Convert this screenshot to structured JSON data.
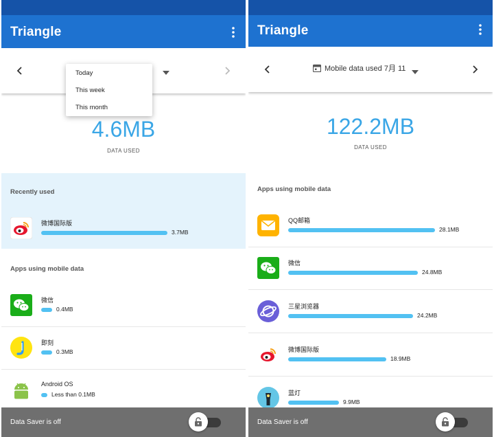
{
  "left": {
    "app_title": "Triangle",
    "usage": {
      "value": "4.6MB",
      "caption": "DATA USED"
    },
    "dropdown_options": [
      "Today",
      "This week",
      "This month"
    ],
    "recent_header": "Recently used",
    "recent_apps": [
      {
        "name": "微博国际版",
        "size": "3.7MB",
        "fraction": 0.8,
        "icon": "weibo-icon"
      }
    ],
    "apps_header": "Apps using mobile data",
    "apps": [
      {
        "name": "微信",
        "size": "0.4MB",
        "fraction": 0.07,
        "icon": "wechat-icon"
      },
      {
        "name": "即刻",
        "size": "0.3MB",
        "fraction": 0.07,
        "icon": "jike-icon"
      },
      {
        "name": "Android OS",
        "size": "Less than 0.1MB",
        "fraction": 0.04,
        "icon": "android-icon"
      }
    ],
    "footer": {
      "text": "Data Saver is off"
    }
  },
  "right": {
    "app_title": "Triangle",
    "period_label": "Mobile data used 7月 11",
    "usage": {
      "value": "122.2MB",
      "caption": "DATA USED"
    },
    "apps_header": "Apps using mobile data",
    "apps": [
      {
        "name": "QQ邮箱",
        "size": "28.1MB",
        "fraction": 0.93,
        "icon": "qqmail-icon"
      },
      {
        "name": "微信",
        "size": "24.8MB",
        "fraction": 0.82,
        "icon": "wechat-icon"
      },
      {
        "name": "三星浏览器",
        "size": "24.2MB",
        "fraction": 0.79,
        "icon": "samsung-browser-icon"
      },
      {
        "name": "微博国际版",
        "size": "18.9MB",
        "fraction": 0.62,
        "icon": "weibo-icon"
      },
      {
        "name": "蓝灯",
        "size": "9.9MB",
        "fraction": 0.32,
        "icon": "lantern-icon"
      }
    ],
    "footer": {
      "text": "Data Saver is off"
    }
  },
  "colors": {
    "status_bar": "#1553a8",
    "app_bar": "#1e72d0",
    "accent_value": "#3aa6e6",
    "usage_bar": "#52c1f2",
    "recent_bg": "#e4f3fc",
    "footer_bg": "#6f6f6f"
  }
}
